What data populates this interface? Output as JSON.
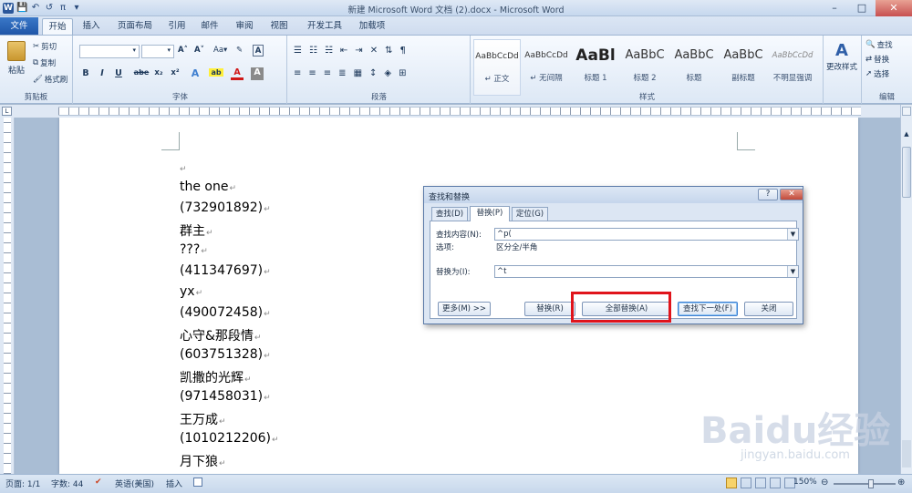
{
  "window": {
    "title": "新建 Microsoft Word 文档 (2).docx - Microsoft Word",
    "min_glyph": "–",
    "max_glyph": "□",
    "close_glyph": "✕"
  },
  "qat": {
    "word_logo": "W",
    "save_glyph": "💾",
    "undo_glyph": "↶",
    "redo_glyph": "↺",
    "pi_glyph": "π",
    "customize_glyph": "▾"
  },
  "tabs": {
    "file": "文件",
    "items": [
      "开始",
      "插入",
      "页面布局",
      "引用",
      "邮件",
      "审阅",
      "视图",
      "开发工具",
      "加载项"
    ]
  },
  "ribbon": {
    "clipboard": {
      "paste": "粘贴",
      "cut": "剪切",
      "copy": "复制",
      "format_painter": "格式刷",
      "label": "剪贴板"
    },
    "font": {
      "label": "字体",
      "grow": "A˄",
      "shrink": "A˅",
      "change_case": "Aa▾",
      "clear": "✎",
      "bold": "B",
      "italic": "I",
      "underline": "U",
      "strike": "abe",
      "subscript": "x₂",
      "superscript": "x²",
      "text_effect": "A",
      "highlight": "ab",
      "font_color": "A",
      "char_shade": "A"
    },
    "paragraph": {
      "label": "段落"
    },
    "styles": {
      "label": "样式",
      "items": [
        {
          "preview": "AaBbCcDd",
          "name": "↵ 正文"
        },
        {
          "preview": "AaBbCcDd",
          "name": "↵ 无间隔"
        },
        {
          "preview": "AaBl",
          "name": "标题 1"
        },
        {
          "preview": "AaBbC",
          "name": "标题 2"
        },
        {
          "preview": "AaBbC",
          "name": "标题"
        },
        {
          "preview": "AaBbC",
          "name": "副标题"
        },
        {
          "preview": "AaBbCcDd",
          "name": "不明显强调"
        }
      ],
      "change_styles": "更改样式"
    },
    "editing": {
      "label": "编辑",
      "find": "查找",
      "replace": "替换",
      "select": "选择"
    }
  },
  "document": {
    "lines": [
      "the one",
      "(732901892)",
      "群主",
      "???",
      "(411347697)",
      "yx",
      "(490072458)",
      "心守&那段情",
      "(603751328)",
      "凯撒的光辉",
      "(971458031)",
      "王万成",
      "(1010212206)",
      "月下狼"
    ],
    "para_mark": "↵"
  },
  "dialog": {
    "title": "查找和替换",
    "help": "?",
    "close": "✕",
    "tabs": [
      "查找(D)",
      "替换(P)",
      "定位(G)"
    ],
    "find_label": "查找内容(N):",
    "find_value": "^p(",
    "options_label": "选项:",
    "options_value": "区分全/半角",
    "replace_label": "替换为(I):",
    "replace_value": "^t",
    "buttons": {
      "more": "更多(M) >>",
      "replace": "替换(R)",
      "replace_all": "全部替换(A)",
      "find_next": "查找下一处(F)",
      "close": "关闭"
    }
  },
  "status": {
    "page": "页面: 1/1",
    "words": "字数: 44",
    "language": "英语(美国)",
    "mode": "插入",
    "zoom": "150%"
  },
  "watermark": {
    "main": "Baidu经验",
    "sub": "jingyan.baidu.com"
  },
  "colors": {
    "accent": "#2b579a",
    "highlight_box": "#e0141b",
    "ribbon_bg": "#dde8f5"
  }
}
